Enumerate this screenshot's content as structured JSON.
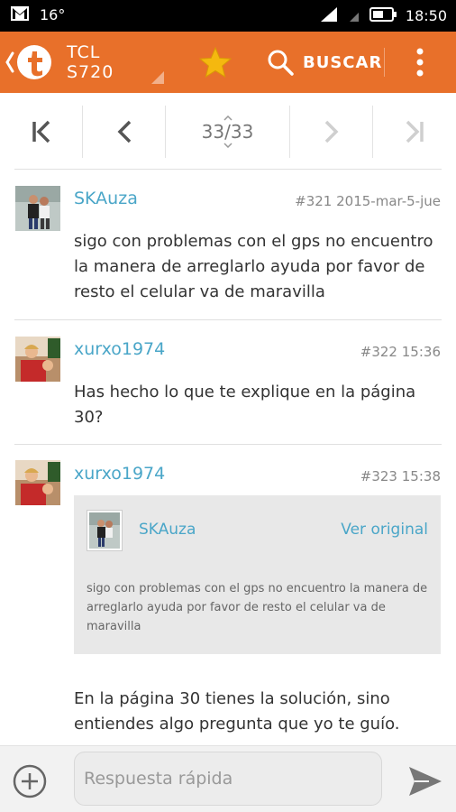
{
  "status_bar": {
    "battery_percent": "16°",
    "time": "18:50"
  },
  "app_bar": {
    "title_line1": "TCL",
    "title_line2": "S720",
    "search_label": "BUSCAR"
  },
  "pager": {
    "page_indicator": "33/33"
  },
  "posts": [
    {
      "username": "SKAuza",
      "number": "#321",
      "date": "2015-mar-5-jue",
      "text": "sigo con problemas con el gps no encuentro la manera de arreglarlo ayuda por favor de resto el celular va de maravilla"
    },
    {
      "username": "xurxo1974",
      "number": "#322",
      "date": "15:36",
      "text": "Has hecho lo que te explique en la página 30?"
    },
    {
      "username": "xurxo1974",
      "number": "#323",
      "date": "15:38",
      "quote": {
        "username": "SKAuza",
        "link_label": "Ver original",
        "text": "sigo con problemas con el gps no encuentro la manera de arreglarlo ayuda por favor de resto el celular va de maravilla"
      },
      "text": "En la página 30 tienes la solución, sino entiendes algo pregunta que yo te guío."
    }
  ],
  "reply": {
    "placeholder": "Respuesta rápida"
  },
  "colors": {
    "accent": "#e8702a",
    "link": "#4aa6c8",
    "star": "#f5b80f"
  }
}
